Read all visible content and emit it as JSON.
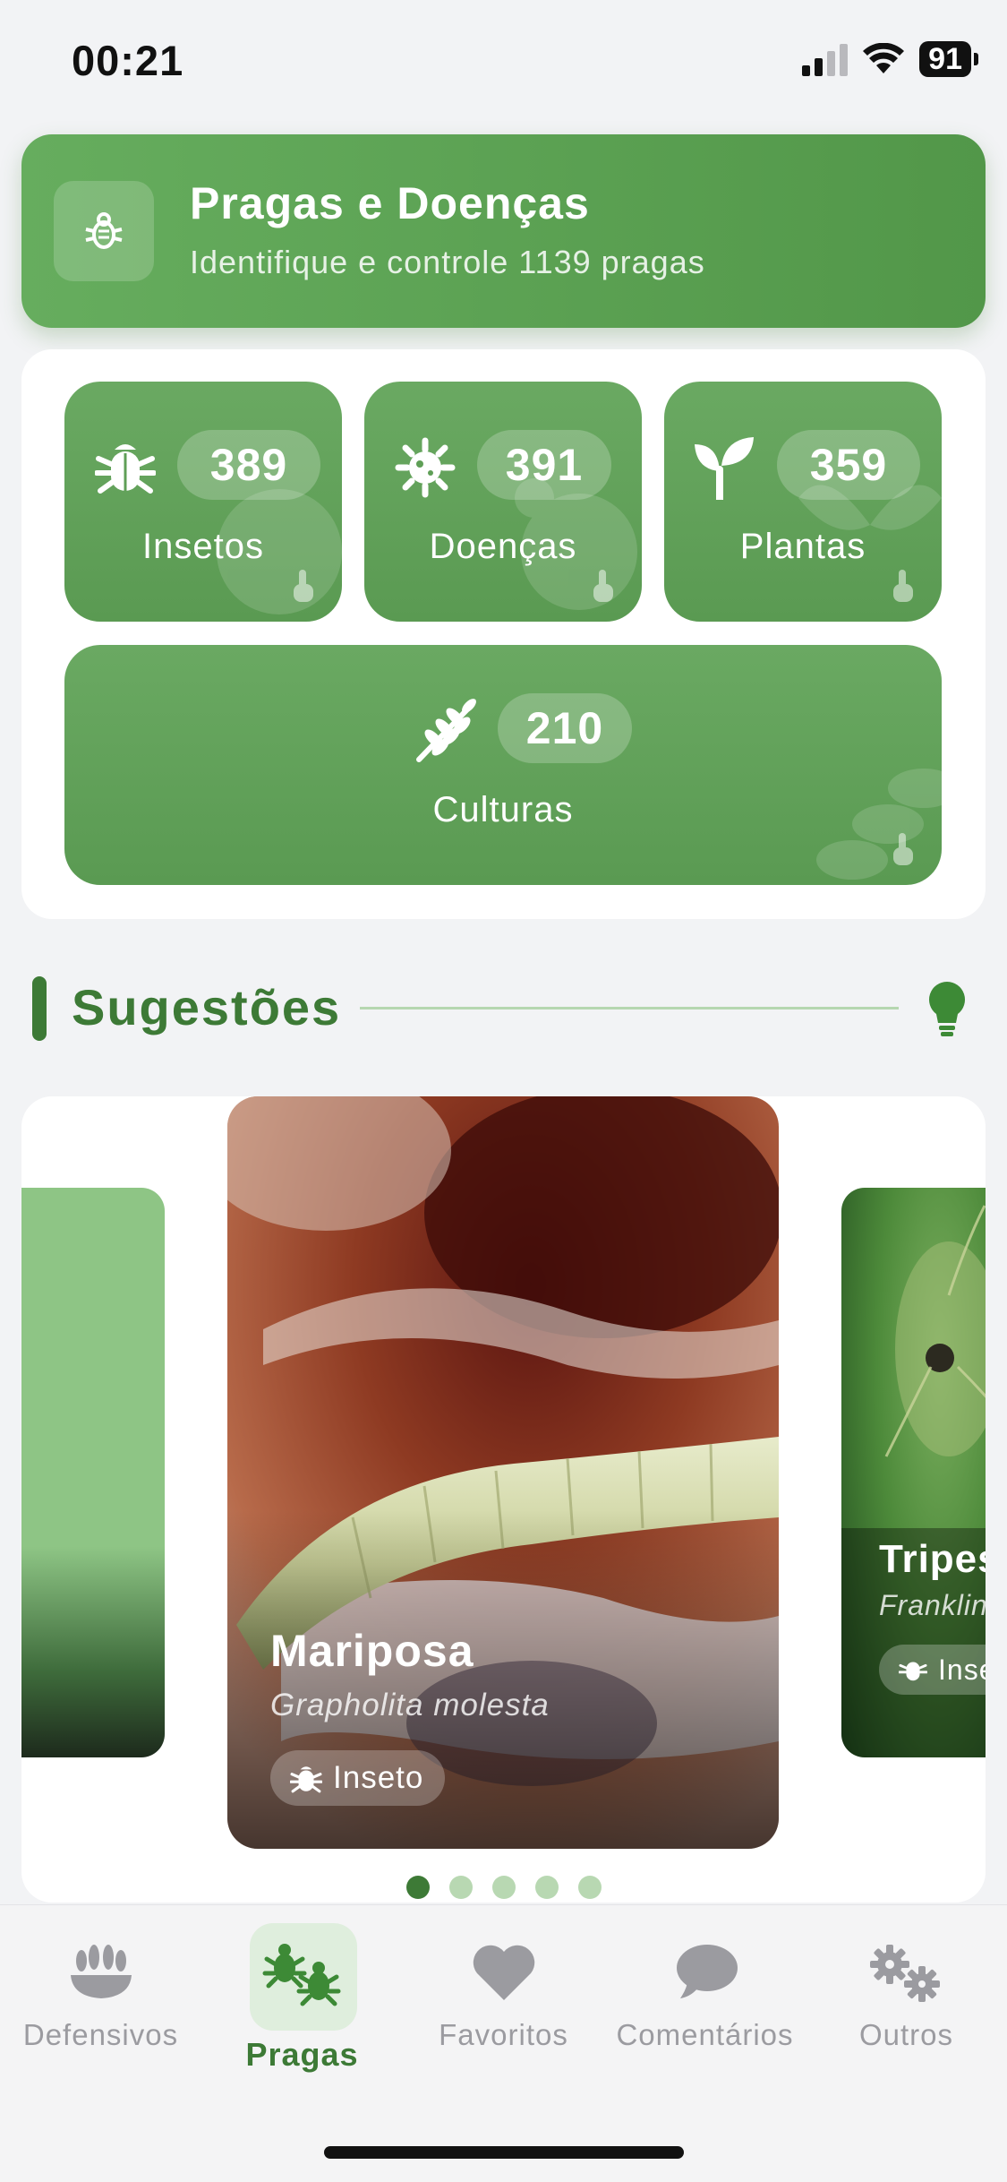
{
  "status_bar": {
    "time": "00:21",
    "battery": "91"
  },
  "header": {
    "title": "Pragas e Doenças",
    "subtitle": "Identifique e controle 1139 pragas",
    "icon": "bug-outline-icon"
  },
  "categories": [
    {
      "label": "Insetos",
      "count": "389",
      "icon": "bug-icon"
    },
    {
      "label": "Doenças",
      "count": "391",
      "icon": "virus-icon"
    },
    {
      "label": "Plantas",
      "count": "359",
      "icon": "seedling-icon"
    },
    {
      "label": "Culturas",
      "count": "210",
      "icon": "wheat-icon"
    }
  ],
  "suggestions": {
    "title": "Sugestões",
    "icon": "lightbulb-icon",
    "cards": [
      {
        "name": "Mariposa",
        "scientific": "Grapholita molesta",
        "type": "Inseto"
      },
      {
        "name": "Tripes",
        "scientific": "Franklin",
        "type": "Inse"
      }
    ],
    "pages": 5,
    "active_page": 1
  },
  "nav": {
    "items": [
      {
        "label": "Defensivos",
        "icon": "grain-bowl-icon"
      },
      {
        "label": "Pragas",
        "icon": "bugs-icon",
        "active": true
      },
      {
        "label": "Favoritos",
        "icon": "heart-icon"
      },
      {
        "label": "Comentários",
        "icon": "chat-bubble-icon"
      },
      {
        "label": "Outros",
        "icon": "gears-icon"
      }
    ]
  },
  "colors": {
    "primary": "#5a9a52",
    "primary_dark": "#3d7a36",
    "accent_light": "#b8d8b2"
  }
}
